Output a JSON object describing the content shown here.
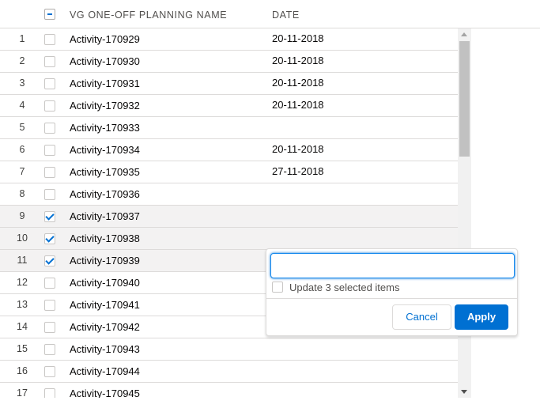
{
  "header": {
    "name_column": "VG ONE-OFF PLANNING NAME",
    "date_column": "DATE"
  },
  "rows": [
    {
      "num": "1",
      "name": "Activity-170929",
      "date": "20-11-2018",
      "selected": false
    },
    {
      "num": "2",
      "name": "Activity-170930",
      "date": "20-11-2018",
      "selected": false
    },
    {
      "num": "3",
      "name": "Activity-170931",
      "date": "20-11-2018",
      "selected": false
    },
    {
      "num": "4",
      "name": "Activity-170932",
      "date": "20-11-2018",
      "selected": false
    },
    {
      "num": "5",
      "name": "Activity-170933",
      "date": "",
      "selected": false
    },
    {
      "num": "6",
      "name": "Activity-170934",
      "date": "20-11-2018",
      "selected": false
    },
    {
      "num": "7",
      "name": "Activity-170935",
      "date": "27-11-2018",
      "selected": false
    },
    {
      "num": "8",
      "name": "Activity-170936",
      "date": "",
      "selected": false
    },
    {
      "num": "9",
      "name": "Activity-170937",
      "date": "",
      "selected": true
    },
    {
      "num": "10",
      "name": "Activity-170938",
      "date": "",
      "selected": true
    },
    {
      "num": "11",
      "name": "Activity-170939",
      "date": "",
      "selected": true
    },
    {
      "num": "12",
      "name": "Activity-170940",
      "date": "",
      "selected": false
    },
    {
      "num": "13",
      "name": "Activity-170941",
      "date": "",
      "selected": false
    },
    {
      "num": "14",
      "name": "Activity-170942",
      "date": "",
      "selected": false
    },
    {
      "num": "15",
      "name": "Activity-170943",
      "date": "",
      "selected": false
    },
    {
      "num": "16",
      "name": "Activity-170944",
      "date": "",
      "selected": false
    },
    {
      "num": "17",
      "name": "Activity-170945",
      "date": "",
      "selected": false
    }
  ],
  "popover": {
    "input_value": "",
    "update_label": "Update 3 selected items",
    "cancel_label": "Cancel",
    "apply_label": "Apply"
  },
  "colors": {
    "brand": "#0070d2",
    "selected_row": "#f3f2f2",
    "border": "#dddbda"
  }
}
